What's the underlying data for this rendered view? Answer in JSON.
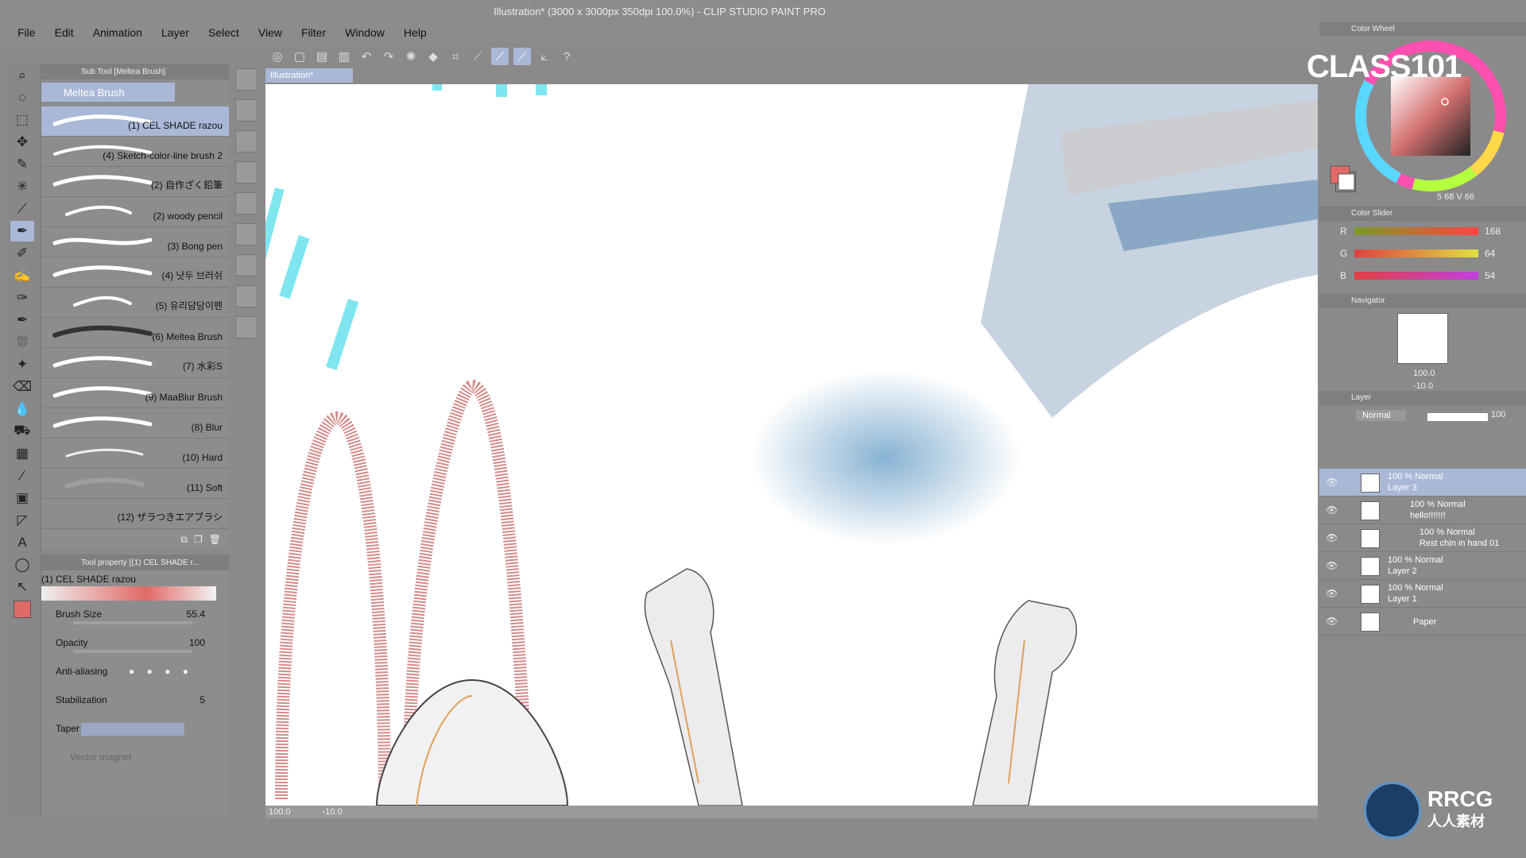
{
  "window": {
    "title": "Illustration* (3000 x 3000px 350dpi 100.0%)  - CLIP STUDIO PAINT PRO"
  },
  "menu": [
    "File",
    "Edit",
    "Animation",
    "Layer",
    "Select",
    "View",
    "Filter",
    "Window",
    "Help"
  ],
  "subtool_panel": {
    "title": "Sub Tool [Meltea Brush]",
    "selected_tab": "Meltea Brush",
    "brushes": [
      "(1) CEL SHADE razou",
      "(4) Sketch-color-line brush 2",
      "(2) 自作ざく鉛筆",
      "(2) woody pencil",
      "(3) Bong pen",
      "(4) 낫두 브러쉬",
      "(5) 유리담당이펜",
      "(6) Meltea Brush",
      "(7) 水彩S",
      "(9) MaaBlur Brush",
      "(8) Blur",
      "(10) Hard",
      "(11) Soft",
      "(12) ザラつきエアブラシ"
    ]
  },
  "tool_property": {
    "title": "Tool property [(1) CEL SHADE r...",
    "brush_name": "(1) CEL SHADE razou",
    "brush_size_label": "Brush Size",
    "brush_size": "55.4",
    "opacity_label": "Opacity",
    "opacity": "100",
    "antialias_label": "Anti-aliasing",
    "stabilization_label": "Stabilization",
    "stabilization": "5",
    "taper_label": "Taper",
    "vector_magnet_label": "Vector magnet"
  },
  "canvas": {
    "tab": "Illustration*",
    "zoom": "100.0",
    "rotation": "-10.0"
  },
  "color_wheel": {
    "title": "Color Wheel",
    "main_color": "#e06a66",
    "sub_color": "#ffffff",
    "readout": "5  68 V 66"
  },
  "color_slider": {
    "title": "Color Slider",
    "r": "168",
    "g": "64",
    "b": "54"
  },
  "navigator": {
    "title": "Navigator",
    "zoom": "100.0",
    "rotation": "-10.0"
  },
  "layer_panel": {
    "title": "Layer",
    "blend_mode": "Normal",
    "opacity": "100",
    "layers": [
      {
        "mode": "100 % Normal",
        "name": "Layer 3"
      },
      {
        "mode": "100 % Normal",
        "name": "hello!!!!!!!"
      },
      {
        "mode": "100 % Normal",
        "name": "Rest chin in hand 01"
      },
      {
        "mode": "100 % Normal",
        "name": "Layer 2"
      },
      {
        "mode": "100 % Normal",
        "name": "Layer 1"
      },
      {
        "mode": "",
        "name": "Paper"
      }
    ]
  },
  "logo": "CLASS101",
  "badge": {
    "line1": "RRCG",
    "line2": "人人素材"
  }
}
